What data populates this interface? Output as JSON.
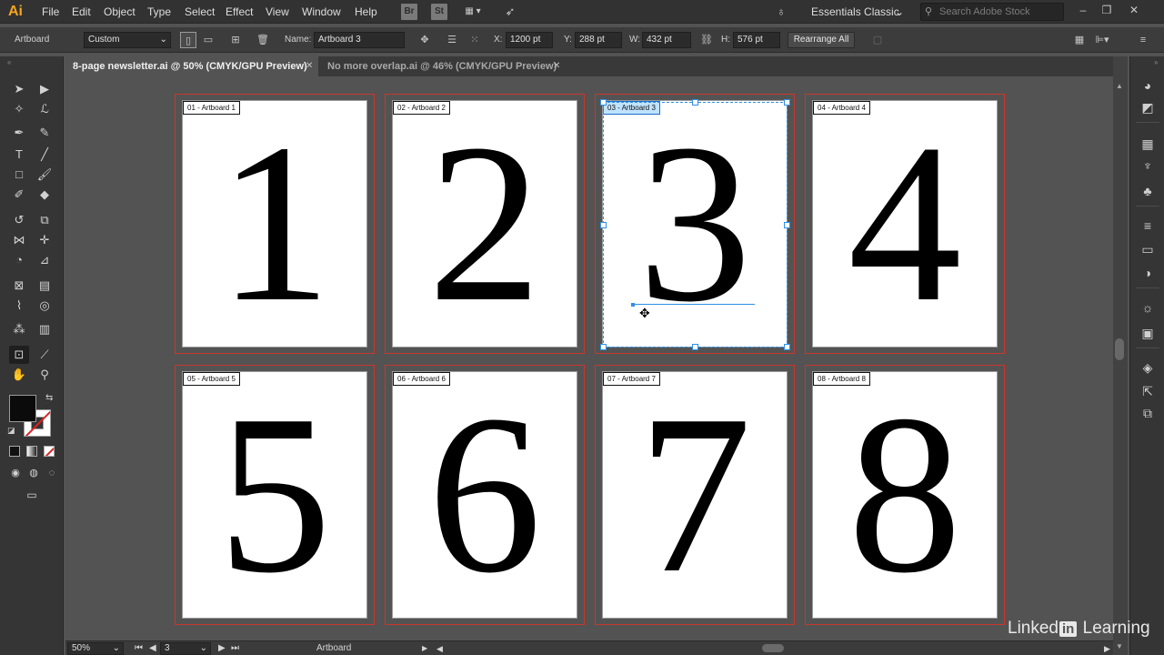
{
  "app": {
    "logo": "Ai"
  },
  "menu": {
    "items": [
      "File",
      "Edit",
      "Object",
      "Type",
      "Select",
      "Effect",
      "View",
      "Window",
      "Help"
    ],
    "bridge_badge": "Br",
    "stock_badge": "St",
    "workspace": "Essentials Classic",
    "stock_search_placeholder": "Search Adobe Stock"
  },
  "control_bar": {
    "context_label": "Artboard",
    "preset": "Custom",
    "name_label": "Name:",
    "name_value": "Artboard 3",
    "x_label": "X:",
    "x_value": "1200 pt",
    "y_label": "Y:",
    "y_value": "288 pt",
    "w_label": "W:",
    "w_value": "432 pt",
    "h_label": "H:",
    "h_value": "576 pt",
    "rearrange_label": "Rearrange All"
  },
  "tabs": [
    {
      "label": "8-page newsletter.ai @ 50% (CMYK/GPU Preview)",
      "active": true
    },
    {
      "label": "No more overlap.ai @ 46% (CMYK/GPU Preview)",
      "active": false
    }
  ],
  "artboards": [
    {
      "label": "01 - Artboard 1",
      "digit": "1"
    },
    {
      "label": "02 - Artboard 2",
      "digit": "2"
    },
    {
      "label": "03 - Artboard 3",
      "digit": "3",
      "selected": true
    },
    {
      "label": "04 - Artboard 4",
      "digit": "4"
    },
    {
      "label": "05 - Artboard 5",
      "digit": "5"
    },
    {
      "label": "06 - Artboard 6",
      "digit": "6"
    },
    {
      "label": "07 - Artboard 7",
      "digit": "7"
    },
    {
      "label": "08 - Artboard 8",
      "digit": "8"
    }
  ],
  "status_bar": {
    "zoom": "50%",
    "artboard_number": "3",
    "tool_name": "Artboard"
  },
  "watermark": {
    "pre": "Linked",
    "in": "in",
    "post": " Learning"
  },
  "colors": {
    "accent_selection": "#2f8fe6",
    "bleed": "#c8372d",
    "logo": "#f7a51c"
  },
  "icons": {
    "toolbar": [
      "selection-tool-icon",
      "direct-selection-tool-icon",
      "magic-wand-tool-icon",
      "lasso-tool-icon",
      "pen-tool-icon",
      "curvature-tool-icon",
      "type-tool-icon",
      "line-tool-icon",
      "rectangle-tool-icon",
      "paintbrush-tool-icon",
      "shaper-tool-icon",
      "eraser-tool-icon",
      "rotate-tool-icon",
      "scale-tool-icon",
      "width-tool-icon",
      "puppet-warp-tool-icon",
      "shape-builder-tool-icon",
      "perspective-grid-tool-icon",
      "mesh-tool-icon",
      "gradient-tool-icon",
      "eyedropper-tool-icon",
      "blend-tool-icon",
      "symbol-sprayer-tool-icon",
      "column-graph-tool-icon",
      "artboard-tool-icon",
      "slice-tool-icon",
      "hand-tool-icon",
      "zoom-tool-icon"
    ]
  }
}
